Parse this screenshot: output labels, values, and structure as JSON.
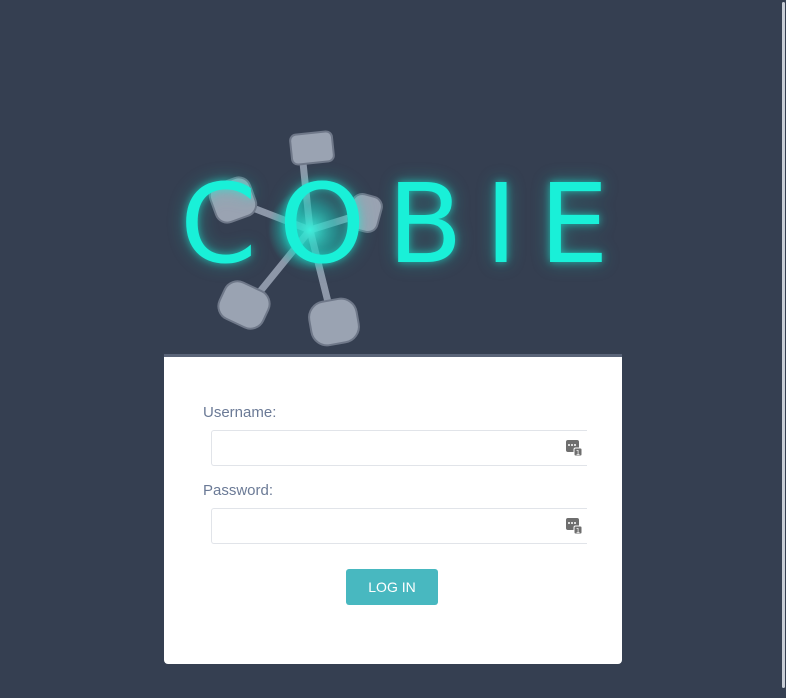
{
  "logo": {
    "text": "COBIE",
    "color": "#19f0d8",
    "icon": "engine-pistons-icon"
  },
  "login_form": {
    "username_label": "Username:",
    "username_value": "",
    "username_placeholder": "",
    "password_label": "Password:",
    "password_value": "",
    "password_placeholder": "",
    "submit_label": "LOG IN",
    "field_icon": "password-manager-key-icon"
  },
  "colors": {
    "background": "#353f51",
    "card": "#ffffff",
    "button": "#48b8c0",
    "label": "#6b7a96"
  }
}
